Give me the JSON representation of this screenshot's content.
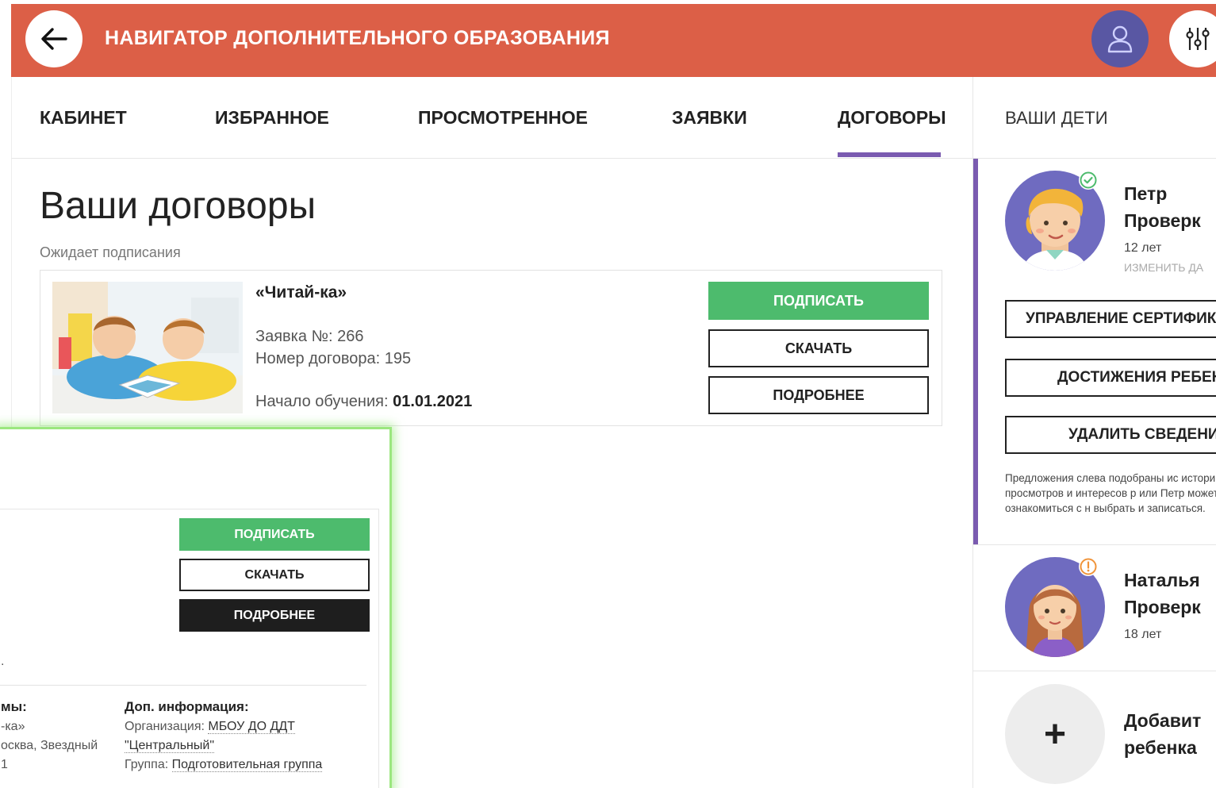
{
  "header": {
    "title": "НАВИГАТОР ДОПОЛНИТЕЛЬНОГО ОБРАЗОВАНИЯ",
    "back_icon": "arrow-left-icon",
    "user_icon": "user-icon",
    "settings_icon": "sliders-icon",
    "accent_color": "#dc5f47"
  },
  "tabs": [
    {
      "label": "КАБИНЕТ"
    },
    {
      "label": "ИЗБРАННОЕ"
    },
    {
      "label": "ПРОСМОТРЕННОЕ"
    },
    {
      "label": "ЗАЯВКИ"
    },
    {
      "label": "ДОГОВОРЫ",
      "active": true
    }
  ],
  "children_panel": {
    "title": "ВАШИ ДЕТИ",
    "children": [
      {
        "first_name": "Петр",
        "last_name": "Проверк",
        "age": "12 лет",
        "edit_link": "ИЗМЕНИТЬ ДА",
        "status": "verified",
        "buttons": [
          "УПРАВЛЕНИЕ СЕРТИФИК",
          "ДОСТИЖЕНИЯ РЕБЕН",
          "УДАЛИТЬ СВЕДЕНИ"
        ],
        "note": "Предложения слева подобраны ис истории просмотров и интересов р или Петр можете ознакомиться с н выбрать и записаться."
      },
      {
        "first_name": "Наталья",
        "last_name": "Проверк",
        "age": "18 лет",
        "status": "warning"
      }
    ],
    "add_child": {
      "line1": "Добавит",
      "line2": "ребенка",
      "icon": "+"
    }
  },
  "main": {
    "page_title": "Ваши договоры",
    "status_label": "Ожидает подписания",
    "contract": {
      "program_name": "«Читай-ка»",
      "application_label": "Заявка №:",
      "application_number": "266",
      "contract_label": "Номер договора:",
      "contract_number": "195",
      "start_label": "Начало обучения:",
      "start_date": "01.01.2021",
      "buttons": {
        "sign": "ПОДПИСАТЬ",
        "download": "СКАЧАТЬ",
        "details": "ПОДРОБНЕЕ"
      }
    }
  },
  "zoom": {
    "buttons": {
      "sign": "ПОДПИСАТЬ",
      "download": "СКАЧАТЬ",
      "details": "ПОДРОБНЕЕ"
    },
    "cut_dot": ".",
    "left_col": {
      "title": "мы:",
      "line1": "-ка»",
      "line2": "осква, Звездный",
      "line3": "1"
    },
    "extra_info": {
      "title": "Доп. информация:",
      "org_label": "Организация:",
      "org_value_1": "МБОУ ДО ДДТ",
      "org_value_2": "\"Центральный\"",
      "group_label": "Группа:",
      "group_value": "Подготовительная группа"
    }
  },
  "colors": {
    "green": "#4dbb6d",
    "purple": "#7a5bb0",
    "avatar_bg": "#6f6bc0",
    "dark_button": "#1e1e1e",
    "highlight_glow": "#9be77f"
  }
}
